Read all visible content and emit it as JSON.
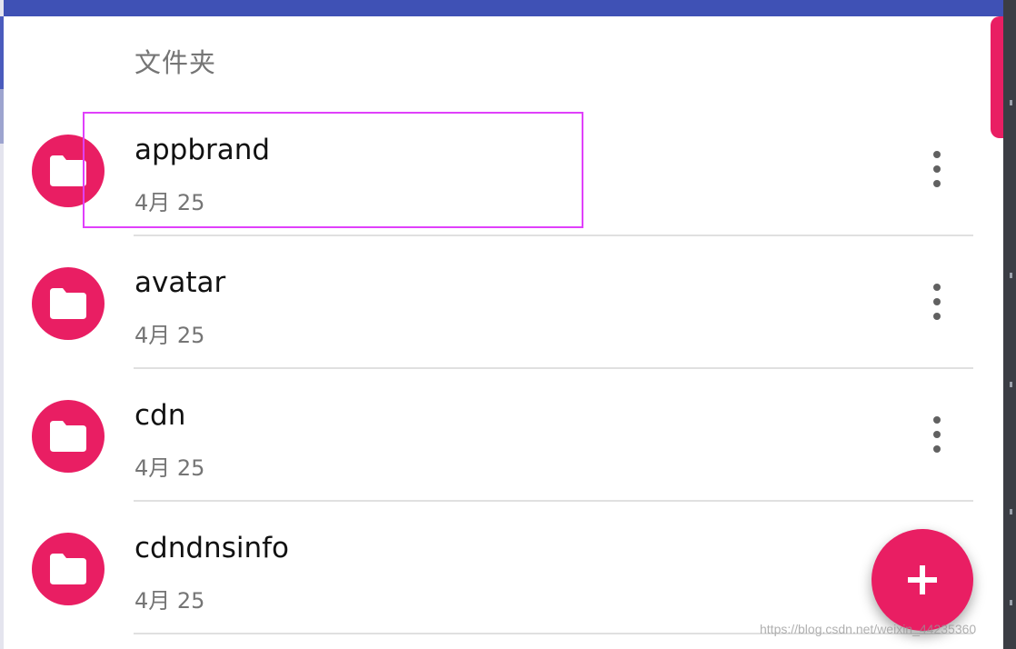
{
  "section_header": "文件夹",
  "folders": [
    {
      "name": "appbrand",
      "date": "4月 25",
      "icon": "folder-icon"
    },
    {
      "name": "avatar",
      "date": "4月 25",
      "icon": "folder-icon"
    },
    {
      "name": "cdn",
      "date": "4月 25",
      "icon": "folder-icon"
    },
    {
      "name": "cdndnsinfo",
      "date": "4月 25",
      "icon": "folder-icon"
    }
  ],
  "fab": {
    "icon": "plus-icon"
  },
  "colors": {
    "accent": "#e91e63",
    "primary": "#3f51b5",
    "selection": "#e040fb"
  },
  "watermark": "https://blog.csdn.net/weixin_44235360"
}
